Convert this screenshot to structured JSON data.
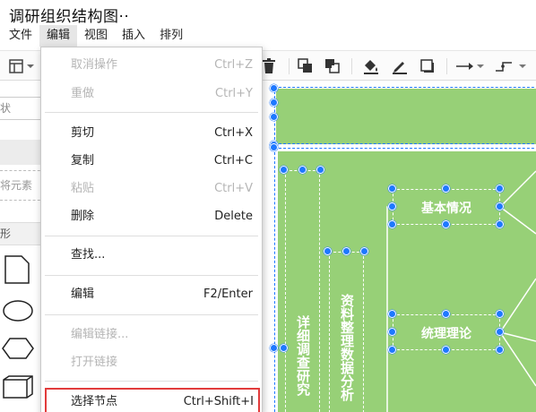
{
  "app": {
    "title": "调研组织结构图··"
  },
  "menubar": {
    "items": [
      "文件",
      "编辑",
      "视图",
      "插入",
      "排列"
    ],
    "active_index": 1
  },
  "toolbar": {
    "icons": [
      "page-view-icon",
      "delete-icon",
      "to-front-icon",
      "to-back-icon",
      "fill-color-icon",
      "line-color-icon",
      "shadow-icon",
      "connection-arrow-icon",
      "waypoints-icon"
    ]
  },
  "sidebar": {
    "search_text": "状",
    "drop_hint": "将元素",
    "section_label": "形",
    "shapes": [
      "document-shape-icon",
      "ellipse-shape-icon",
      "hexagon-shape-icon",
      "cube-shape-icon"
    ]
  },
  "edit_menu": {
    "items": [
      {
        "label": "取消操作",
        "shortcut": "Ctrl+Z",
        "disabled": true
      },
      {
        "label": "重做",
        "shortcut": "Ctrl+Y",
        "disabled": true
      },
      {
        "label": "剪切",
        "shortcut": "Ctrl+X",
        "disabled": false
      },
      {
        "label": "复制",
        "shortcut": "Ctrl+C",
        "disabled": false
      },
      {
        "label": "粘贴",
        "shortcut": "Ctrl+V",
        "disabled": true
      },
      {
        "label": "删除",
        "shortcut": "Delete",
        "disabled": false
      },
      {
        "label": "查找...",
        "shortcut": "",
        "disabled": false
      },
      {
        "label": "编辑",
        "shortcut": "F2/Enter",
        "disabled": false
      },
      {
        "label": "编辑链接...",
        "shortcut": "",
        "disabled": true
      },
      {
        "label": "打开链接",
        "shortcut": "",
        "disabled": true
      },
      {
        "label": "选择节点",
        "shortcut": "Ctrl+Shift+I",
        "disabled": false,
        "highlighted": true
      }
    ]
  },
  "diagram": {
    "top_bar_text": "",
    "nodes": {
      "detailed_research": "详细调查研究",
      "data_analysis": "资料整理数据分析",
      "basic_info": "基本情况",
      "theory": "统理理论"
    },
    "fill_color": "#97d077",
    "selection_color": "#1e78ff"
  }
}
